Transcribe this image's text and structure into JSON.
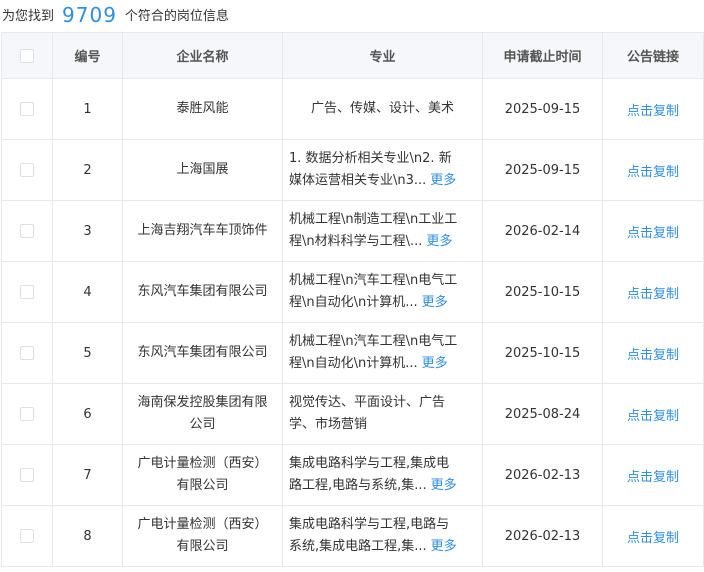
{
  "summary": {
    "prefix": "为您找到",
    "count": "9709",
    "suffix": "个符合的岗位信息"
  },
  "headers": {
    "no": "编号",
    "company": "企业名称",
    "major": "专业",
    "deadline": "申请截止时间",
    "link": "公告链接"
  },
  "rows": [
    {
      "no": "1",
      "company": [
        "泰胜风能"
      ],
      "major": [
        "广告、传媒、设计、美术"
      ],
      "more": "",
      "deadline": "2025-09-15",
      "link": "点击复制"
    },
    {
      "no": "2",
      "company": [
        "上海国展"
      ],
      "major": [
        "1. 数据分析相关专业\\n2. 新",
        "媒体运营相关专业\\n3..."
      ],
      "more": "更多",
      "deadline": "2025-09-15",
      "link": "点击复制"
    },
    {
      "no": "3",
      "company": [
        "上海吉翔汽车车顶饰件"
      ],
      "major": [
        "机械工程\\n制造工程\\n工业工",
        "程\\n材料科学与工程\\..."
      ],
      "more": "更多",
      "deadline": "2026-02-14",
      "link": "点击复制"
    },
    {
      "no": "4",
      "company": [
        "东风汽车集团有限公司"
      ],
      "major": [
        "机械工程\\n汽车工程\\n电气工",
        "程\\n自动化\\n计算机..."
      ],
      "more": "更多",
      "deadline": "2025-10-15",
      "link": "点击复制"
    },
    {
      "no": "5",
      "company": [
        "东风汽车集团有限公司"
      ],
      "major": [
        "机械工程\\n汽车工程\\n电气工",
        "程\\n自动化\\n计算机..."
      ],
      "more": "更多",
      "deadline": "2025-10-15",
      "link": "点击复制"
    },
    {
      "no": "6",
      "company": [
        "海南保发控股集团有限",
        "公司"
      ],
      "major": [
        "视觉传达、平面设计、广告",
        "学、市场营销"
      ],
      "more": "",
      "deadline": "2025-08-24",
      "link": "点击复制"
    },
    {
      "no": "7",
      "company": [
        "广电计量检测（西安）",
        "有限公司"
      ],
      "major": [
        "集成电路科学与工程,集成电",
        "路工程,电路与系统,集..."
      ],
      "more": "更多",
      "deadline": "2026-02-13",
      "link": "点击复制"
    },
    {
      "no": "8",
      "company": [
        "广电计量检测（西安）",
        "有限公司"
      ],
      "major": [
        "集成电路科学与工程,电路与",
        "系统,集成电路工程,集..."
      ],
      "more": "更多",
      "deadline": "2026-02-13",
      "link": "点击复制"
    }
  ]
}
